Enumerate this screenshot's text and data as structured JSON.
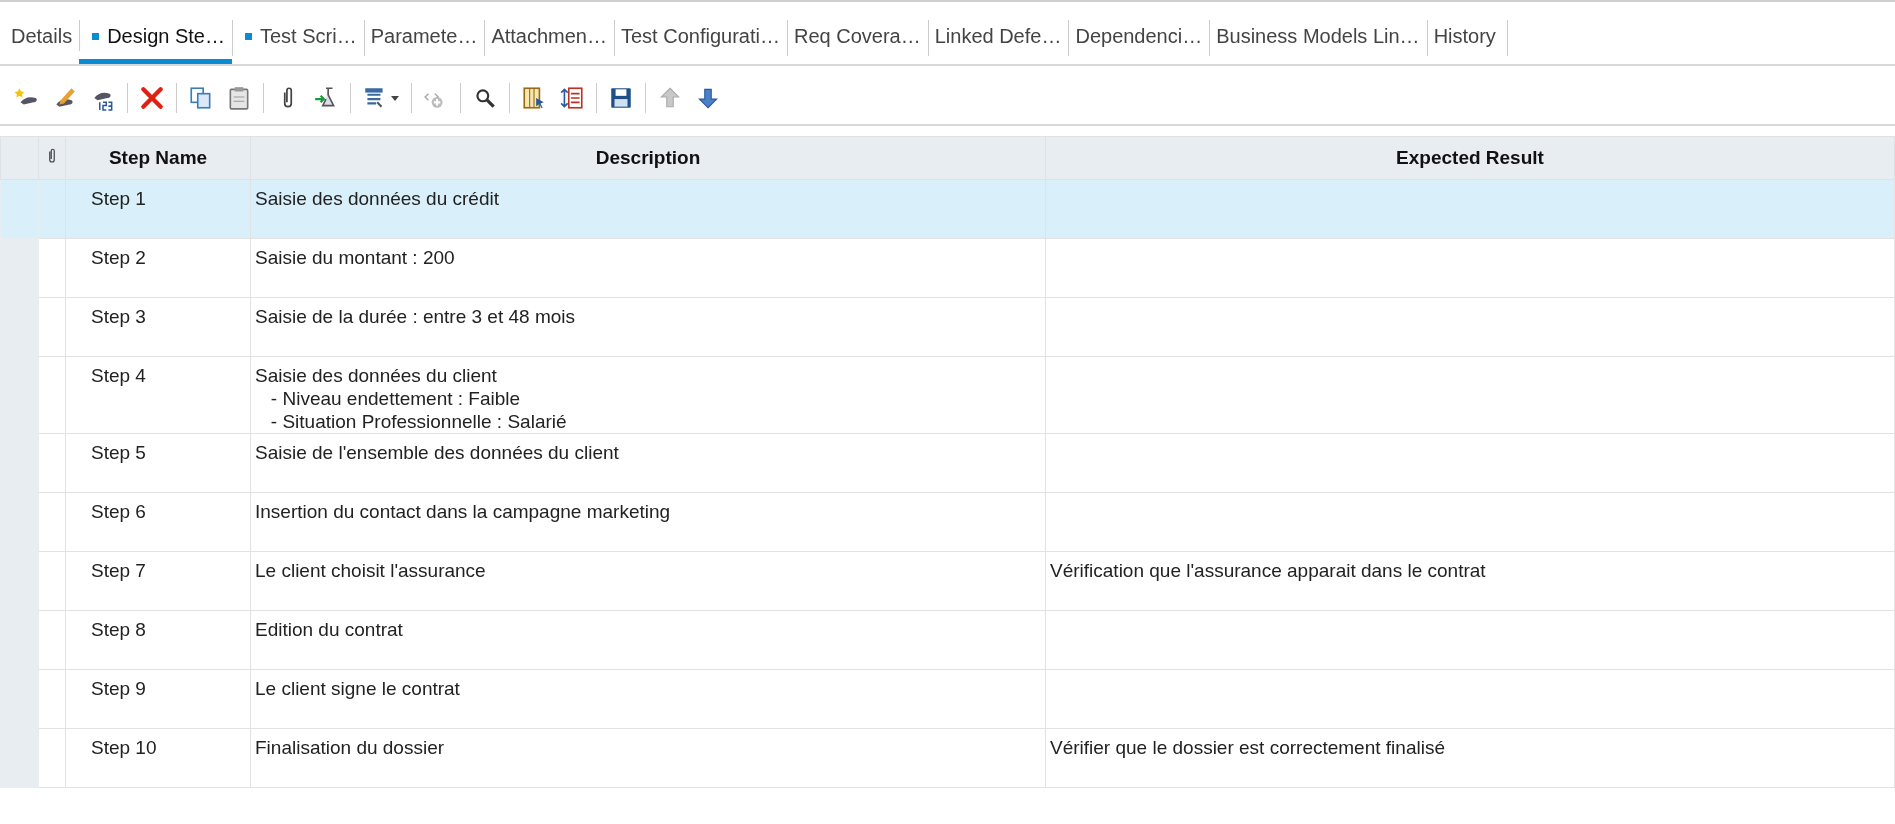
{
  "tabs": [
    {
      "label": "Details",
      "selected": false,
      "marked": false
    },
    {
      "label": "Design Ste…",
      "selected": true,
      "marked": true
    },
    {
      "label": "Test Scri…",
      "selected": false,
      "marked": true
    },
    {
      "label": "Paramete…",
      "selected": false,
      "marked": false
    },
    {
      "label": "Attachmen…",
      "selected": false,
      "marked": false
    },
    {
      "label": "Test Configurati…",
      "selected": false,
      "marked": false
    },
    {
      "label": "Req Covera…",
      "selected": false,
      "marked": false
    },
    {
      "label": "Linked Defe…",
      "selected": false,
      "marked": false
    },
    {
      "label": "Dependenci…",
      "selected": false,
      "marked": false
    },
    {
      "label": "Business Models Lin…",
      "selected": false,
      "marked": false
    },
    {
      "label": "History",
      "selected": false,
      "marked": false
    }
  ],
  "table": {
    "columns": [
      "Step Name",
      "Description",
      "Expected Result"
    ],
    "rows": [
      {
        "step_name": "Step 1",
        "description": "Saisie des données du crédit",
        "expected_result": "",
        "selected": true
      },
      {
        "step_name": "Step 2",
        "description": "Saisie du montant : 200",
        "expected_result": "",
        "selected": false
      },
      {
        "step_name": "Step 3",
        "description": "Saisie de la durée : entre 3 et 48 mois",
        "expected_result": "",
        "selected": false
      },
      {
        "step_name": "Step 4",
        "description": "Saisie des données du client\n   - Niveau endettement : Faible\n   - Situation Professionnelle : Salarié",
        "expected_result": "",
        "selected": false
      },
      {
        "step_name": "Step 5",
        "description": "Saisie de l'ensemble des données du client",
        "expected_result": "",
        "selected": false
      },
      {
        "step_name": "Step 6",
        "description": "Insertion du contact dans la campagne marketing",
        "expected_result": "",
        "selected": false
      },
      {
        "step_name": "Step 7",
        "description": "Le client choisit l'assurance",
        "expected_result": "Vérification que l'assurance apparait dans le contrat",
        "selected": false
      },
      {
        "step_name": "Step 8",
        "description": "Edition du contrat",
        "expected_result": "",
        "selected": false
      },
      {
        "step_name": "Step 9",
        "description": "Le client signe le contrat",
        "expected_result": "",
        "selected": false
      },
      {
        "step_name": "Step 10",
        "description": "Finalisation du dossier",
        "expected_result": "Vérifier que le dossier est correctement finalisé",
        "selected": false
      }
    ]
  }
}
